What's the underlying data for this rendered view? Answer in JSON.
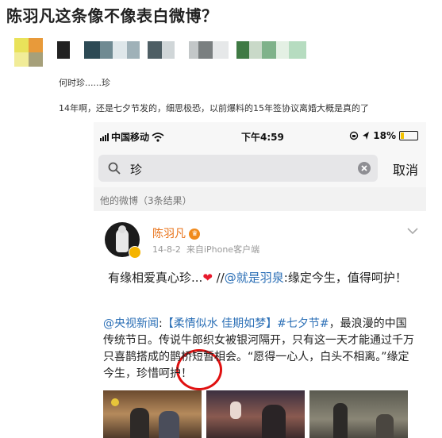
{
  "article": {
    "title": "陈羽凡这条像不像表白微博？",
    "comment_1": "何时珍......珍",
    "comment_2": "14年啊，还是七夕节发的，细思极恐，以前爆料的15年签协议离婚大概是真的了"
  },
  "status_bar": {
    "carrier": "中国移动",
    "time": "下午4:59",
    "battery": "18%"
  },
  "search": {
    "query": "珍",
    "cancel": "取消"
  },
  "section_label": "他的微博（3条结果）",
  "post": {
    "user": "陈羽凡",
    "date": "14-8-2",
    "source": "来自iPhone客户端",
    "text_1": "有缘相爱真心珍...",
    "text_1_tail": "//",
    "mention": "@就是羽泉",
    "text_1_end": ":缘定今生，值得呵护！",
    "repost_user": "@央视新闻",
    "repost_tag1": "【柔情似水 佳期如梦】",
    "repost_tag2": "#七夕节#",
    "repost_text": "，最浪漫的中国传统节日。传说牛郎织女被银河隔开，只有这一天才能通过千万只喜鹊搭成的鹊桥短暂相会。“愿得一心人，白头不相离。”缘定今生，珍惜呵护！"
  },
  "colors": {
    "username": "#e8731a",
    "link": "#2b6fb6",
    "annotation": "#e01010",
    "heart": "#e8192c"
  }
}
